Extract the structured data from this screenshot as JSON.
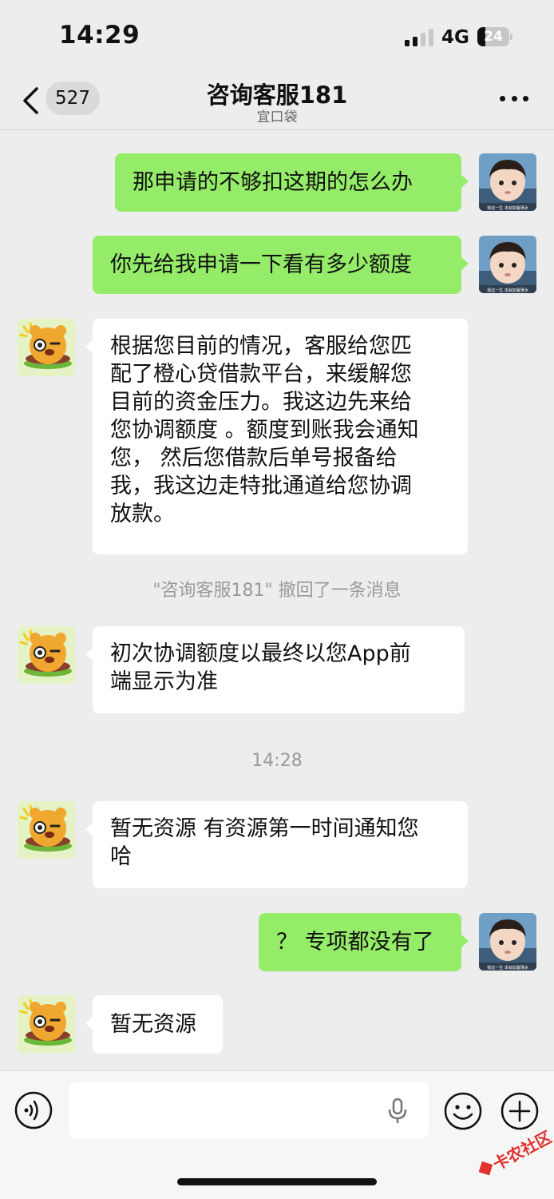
{
  "status_bar": {
    "time": "14:29",
    "network": "4G",
    "battery": "24",
    "battery_level_percent": 24
  },
  "nav": {
    "unread_count": "527",
    "title": "咨询客服181",
    "subtitle": "宜口袋",
    "back_icon": "chevron-left-icon",
    "more_icon": "more-dots-icon"
  },
  "messages": [
    {
      "sender": "me",
      "text": "那申请的不够扣这期的怎么办"
    },
    {
      "sender": "me",
      "text": "你先给我申请一下看有多少额度"
    },
    {
      "sender": "agent",
      "text": "根据您目前的情况，客服给您匹\n配了橙心贷借款平台，来缓解您\n目前的资金压力。我这边先来给\n您协调额度 。额度到账我会通知\n您， 然后您借款后单号报备给\n我，我这边走特批通道给您协调\n放款。"
    },
    {
      "sender": "system",
      "text": "\"咨询客服181\" 撤回了一条消息"
    },
    {
      "sender": "agent",
      "text": "初次协调额度以最终以您App前\n端显示为准"
    },
    {
      "sender": "timestamp",
      "text": "14:28"
    },
    {
      "sender": "agent",
      "text": "暂无资源 有资源第一时间通知您\n哈"
    },
    {
      "sender": "me",
      "text": "？ 专项都没有了"
    },
    {
      "sender": "agent",
      "text": "暂无资源"
    }
  ],
  "avatars": {
    "me_caption": "我这一生 本就如履薄冰",
    "agent_icon": "cartoon-burger-bear-avatar"
  },
  "input_bar": {
    "voice_icon": "voice-wave-icon",
    "mic_icon": "microphone-icon",
    "emoji_icon": "smiley-icon",
    "plus_icon": "plus-circle-icon"
  },
  "watermark": {
    "text": "卡农社区"
  },
  "colors": {
    "my_bubble": "#95ec69",
    "their_bubble": "#ffffff",
    "background": "#ededed"
  }
}
